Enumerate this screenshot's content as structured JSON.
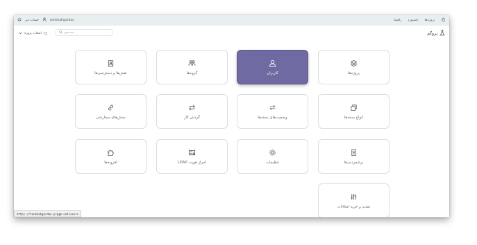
{
  "topbar": {
    "username": "tankhahgardan",
    "account": "حساب من",
    "nav": [
      "پروژه‌ها",
      "داشبورد",
      "راهنما"
    ]
  },
  "subbar": {
    "brand": "پروگم",
    "search_placeholder": "جستجو...",
    "project_select": "انتخاب پروژه"
  },
  "tiles": {
    "projects": "پروژه‌ها",
    "users": "کاربران",
    "groups": "گروه‌ها",
    "roles": "نقش‌ها و دسترسی‌ها",
    "task_types": "انواع بسته‌ها",
    "task_statuses": "وضعیت‌های بسته‌ها",
    "workflow": "گردش کار",
    "custom_fields": "بخش‌های سفارشی",
    "enumerations": "برشمردنی‌ها",
    "settings": "تنظیمات",
    "ldap": "احراز هویت LDAP",
    "plugins": "افزونه‌ها",
    "license": "تمدید و خرید امکانات"
  },
  "status_url": "https://tankhahgardan.prpgm.net/users",
  "colors": {
    "active_tile": "#6f6aa1",
    "topbar": "#e9eef1"
  }
}
